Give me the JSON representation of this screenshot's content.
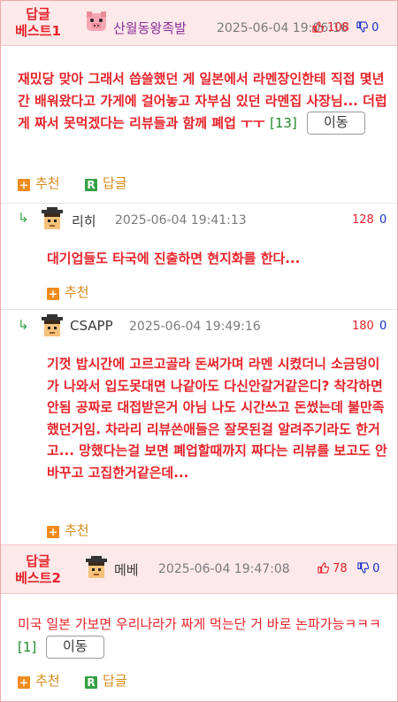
{
  "best1": {
    "label_line1": "답글",
    "label_line2": "베스트1",
    "nick": "산월동왕족발",
    "date": "2025-06-04 19:06:16",
    "up": "108",
    "down": "0",
    "text": "재밌당 맞아 그래서 씁쓸했던 게 일본에서 라멘장인한테 직접 몇년간 배워왔다고 가게에 걸어놓고 자부심 있던 라멘집 사장님... 더럽게 짜서 못먹겠다는 리뷰들과 함께 폐업 ㅜㅜ",
    "count": "[13]",
    "move_label": "이동",
    "recommend_label": "추천",
    "reply_label": "답글"
  },
  "reply1": {
    "nick": "리히",
    "date": "2025-06-04 19:41:13",
    "up": "128",
    "down": "0",
    "text": "대기업들도 타국에 진출하면 현지화를 한다...",
    "recommend_label": "추천"
  },
  "reply2": {
    "nick": "CSAPP",
    "date": "2025-06-04 19:49:16",
    "up": "180",
    "down": "0",
    "text": "기껏 밥시간에 고르고골라 돈써가며 라멘 시켰더니 소금덩이가 나와서 입도못대면 나같아도 다신안갈거같은디? 착각하면안됨 공짜로 대접받은거 아님 나도 시간쓰고 돈썼는데 불만족했던거임. 차라리 리뷰쓴애들은 잘못된걸 알려주기라도 한거고... 망했다는걸 보면 폐업할때까지 짜다는 리뷰를 보고도 안바꾸고 고집한거같은데...",
    "recommend_label": "추천"
  },
  "best2": {
    "label_line1": "답글",
    "label_line2": "베스트2",
    "nick": "메베",
    "date": "2025-06-04 19:47:08",
    "up": "78",
    "down": "0",
    "text": "미국 일본 가보면 우리나라가 짜게 먹는단 거 바로 논파가능ㅋㅋㅋ",
    "count": "[1]",
    "move_label": "이동",
    "recommend_label": "추천",
    "reply_label": "답글"
  },
  "icons": {
    "reply_arrow": "reply-arrow-icon",
    "thumbs_up": "thumbs-up-icon",
    "thumbs_down": "thumbs-down-icon",
    "plus": "plus-square-icon",
    "reply_r": "reply-r-square-icon"
  },
  "colors": {
    "best_red": "#e8242b",
    "best_bg": "#fde9ea",
    "border_pink": "#f0a9ad",
    "count_green": "#1f8a2e",
    "down_blue": "#1530c8",
    "recommend_orange": "#f08c1f",
    "reply_green": "#34a045"
  }
}
